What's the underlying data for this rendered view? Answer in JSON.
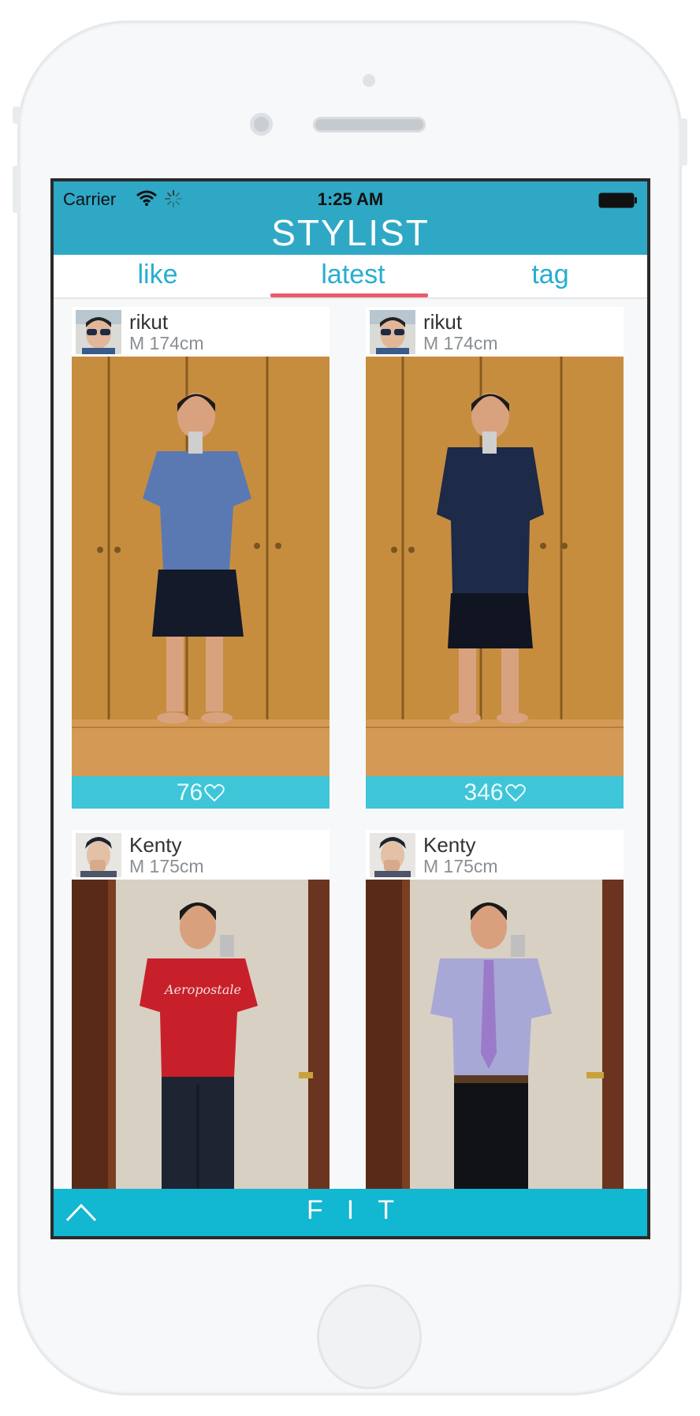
{
  "status": {
    "carrier": "Carrier",
    "time": "1:25 AM"
  },
  "app": {
    "title": "STYLIST"
  },
  "tabs": [
    {
      "label": "like"
    },
    {
      "label": "latest"
    },
    {
      "label": "tag"
    }
  ],
  "active_tab": "latest",
  "posts": [
    {
      "user": "rikut",
      "meta": "M 174cm",
      "likes": "76",
      "outfit": "blue-tshirt"
    },
    {
      "user": "rikut",
      "meta": "M 174cm",
      "likes": "346",
      "outfit": "navy-hoodie"
    },
    {
      "user": "Kenty",
      "meta": "M 175cm",
      "likes": "",
      "outfit": "red-tshirt"
    },
    {
      "user": "Kenty",
      "meta": "M 175cm",
      "likes": "",
      "outfit": "lavender-shirt"
    }
  ],
  "bottom": {
    "label": "FIT"
  },
  "colors": {
    "header": "#2fa8c5",
    "accent_text": "#27aed0",
    "tab_indicator": "#ec5a6a",
    "likes_bar": "#3fc5d8",
    "bottom_bar": "#12b7d1"
  },
  "icons": [
    "wifi-icon",
    "activity-spinner-icon",
    "battery-icon",
    "heart-icon",
    "chevron-up-icon"
  ]
}
